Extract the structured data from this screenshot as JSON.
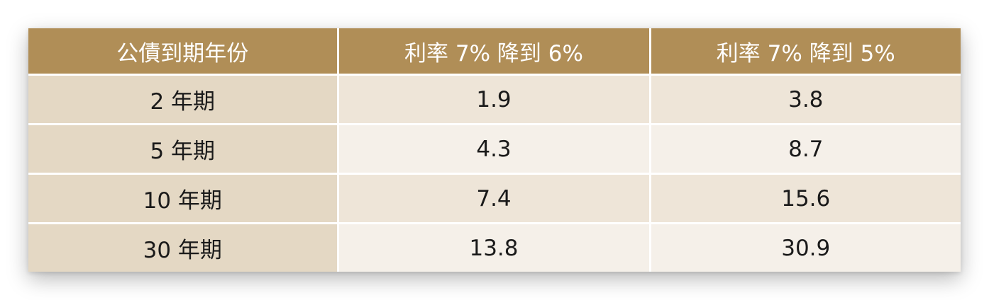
{
  "table": {
    "headers": [
      "公債到期年份",
      "利率 7% 降到 6%",
      "利率 7% 降到 5%"
    ],
    "rows": [
      {
        "term": "2 年期",
        "to6": "1.9",
        "to5": "3.8"
      },
      {
        "term": "5 年期",
        "to6": "4.3",
        "to5": "8.7"
      },
      {
        "term": "10 年期",
        "to6": "7.4",
        "to5": "15.6"
      },
      {
        "term": "30 年期",
        "to6": "13.8",
        "to5": "30.9"
      }
    ]
  },
  "colors": {
    "header_bg": "#b08e57",
    "label_col_bg": "#e4d8c4",
    "row_odd_bg": "#eee5d8",
    "row_even_bg": "#f5f0e9"
  }
}
